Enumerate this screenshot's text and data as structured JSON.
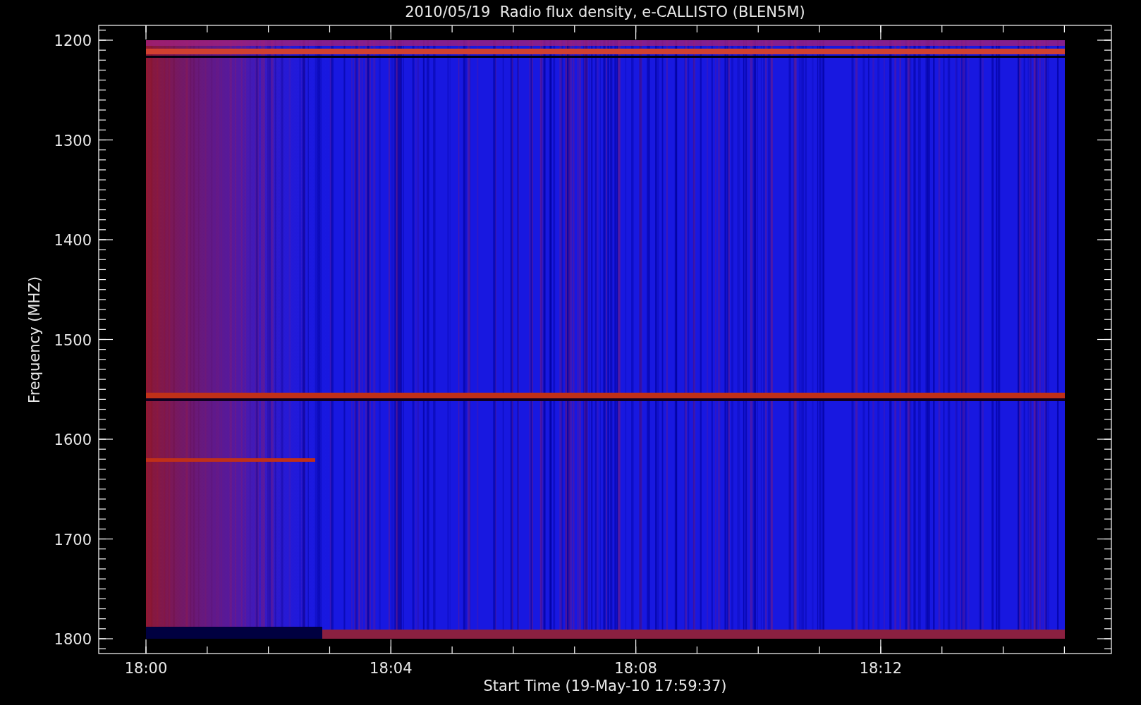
{
  "title": "2010/05/19  Radio flux density, e-CALLISTO (BLEN5M)",
  "y_axis": {
    "label": "Frequency (MHZ)",
    "ticks": [
      "1200",
      "1300",
      "1400",
      "1500",
      "1600",
      "1700",
      "1800"
    ]
  },
  "x_axis": {
    "label": "Start Time (19-May-10 17:59:37)",
    "ticks": [
      "18:00",
      "18:04",
      "18:08",
      "18:12"
    ]
  }
}
